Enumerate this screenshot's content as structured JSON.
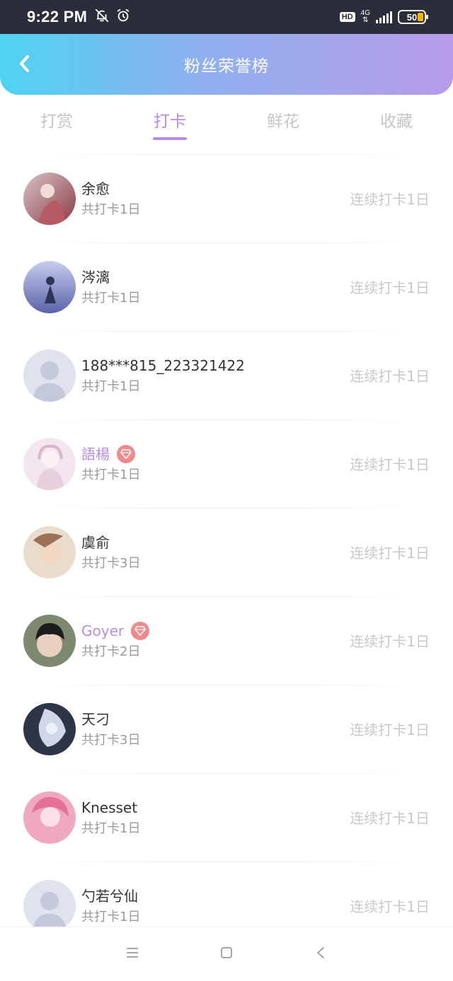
{
  "status_bar": {
    "time": "9:22 PM",
    "hd": "HD",
    "network": "4G",
    "battery": "50",
    "icons": [
      "bell-off-icon",
      "alarm-icon",
      "signal-icon",
      "battery-icon"
    ]
  },
  "header": {
    "title": "粉丝荣誉榜",
    "back_icon": "chevron-left-icon"
  },
  "colors": {
    "header_gradient_start": "#4fd3f1",
    "header_gradient_end": "#b79be9",
    "accent": "#b68de6",
    "badge": "#f08a8a"
  },
  "tabs": [
    {
      "label": "打赏",
      "active": false
    },
    {
      "label": "打卡",
      "active": true
    },
    {
      "label": "鲜花",
      "active": false
    },
    {
      "label": "收藏",
      "active": false
    }
  ],
  "list": [
    {
      "name": "余愈",
      "total": "共打卡1日",
      "streak": "连续打卡1日",
      "vip": false
    },
    {
      "name": "涔漓",
      "total": "共打卡1日",
      "streak": "连续打卡1日",
      "vip": false
    },
    {
      "name": "188***815_223321422",
      "total": "共打卡1日",
      "streak": "连续打卡1日",
      "vip": false
    },
    {
      "name": "語楊",
      "total": "共打卡1日",
      "streak": "连续打卡1日",
      "vip": true
    },
    {
      "name": "虞俞",
      "total": "共打卡3日",
      "streak": "连续打卡1日",
      "vip": false
    },
    {
      "name": "Goyer",
      "total": "共打卡2日",
      "streak": "连续打卡1日",
      "vip": true
    },
    {
      "name": "天刁",
      "total": "共打卡3日",
      "streak": "连续打卡1日",
      "vip": false
    },
    {
      "name": "Knesset",
      "total": "共打卡1日",
      "streak": "连续打卡1日",
      "vip": false
    },
    {
      "name": "勺若兮仙",
      "total": "共打卡1日",
      "streak": "连续打卡1日",
      "vip": false
    }
  ],
  "nav": {
    "buttons": [
      "menu-icon",
      "home-square-icon",
      "back-triangle-icon"
    ]
  }
}
